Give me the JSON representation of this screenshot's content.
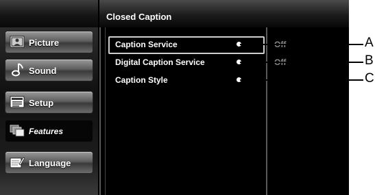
{
  "header": {
    "title": "Closed Caption"
  },
  "sidebar": {
    "items": [
      {
        "label": "Picture",
        "icon": "picture-icon",
        "active": false
      },
      {
        "label": "Sound",
        "icon": "music-note-icon",
        "active": false
      },
      {
        "label": "Setup",
        "icon": "setup-icon",
        "active": false
      },
      {
        "label": "Features",
        "icon": "features-icon",
        "active": true
      },
      {
        "label": "Language",
        "icon": "language-icon",
        "active": false
      }
    ]
  },
  "menu": {
    "rows": [
      {
        "label": "Caption Service",
        "value": "Off",
        "selected": true
      },
      {
        "label": "Digital Caption Service",
        "value": "Off",
        "selected": false
      },
      {
        "label": "Caption Style",
        "value": "",
        "selected": false
      }
    ]
  },
  "callouts": [
    "A",
    "B",
    "C"
  ]
}
